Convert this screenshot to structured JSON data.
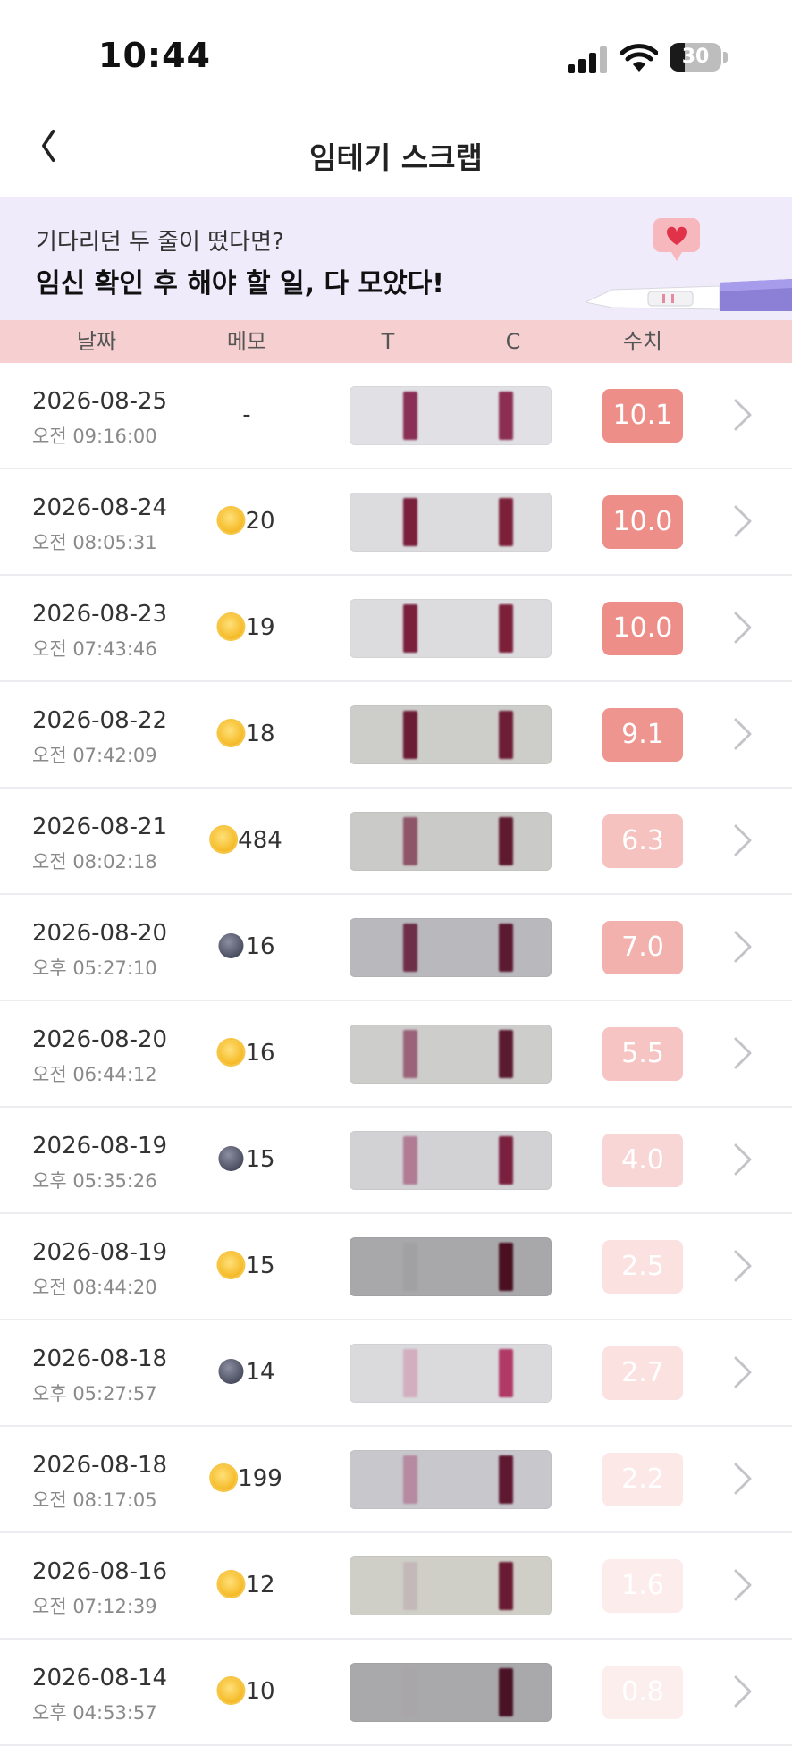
{
  "status_bar": {
    "time": "10:44",
    "battery_level": "30",
    "battery_fraction": 0.3
  },
  "header": {
    "title": "임테기 스크랩"
  },
  "banner": {
    "subtitle": "기다리던 두 줄이 떴다면?",
    "title": "임신 확인 후 해야 할 일, 다 모았다!"
  },
  "table": {
    "columns": {
      "date": "날짜",
      "memo": "메모",
      "t": "T",
      "c": "C",
      "value": "수치"
    },
    "rows": [
      {
        "date": "2026-08-25",
        "time": "오전 09:16:00",
        "memo_icon": "",
        "memo": "-",
        "value": "10.1",
        "badge_color": "#ee8e89",
        "strip_bg": "#e1e1e5",
        "t_color": "#8a2f55",
        "c_color": "#8c2e50"
      },
      {
        "date": "2026-08-24",
        "time": "오전 08:05:31",
        "memo_icon": "sun",
        "memo": "20",
        "value": "10.0",
        "badge_color": "#ee8e89",
        "strip_bg": "#dcdcde",
        "t_color": "#7a1f3c",
        "c_color": "#7c203a"
      },
      {
        "date": "2026-08-23",
        "time": "오전 07:43:46",
        "memo_icon": "sun",
        "memo": "19",
        "value": "10.0",
        "badge_color": "#ee8e89",
        "strip_bg": "#dcdcdf",
        "t_color": "#7a1f3c",
        "c_color": "#7c203a"
      },
      {
        "date": "2026-08-22",
        "time": "오전 07:42:09",
        "memo_icon": "sun",
        "memo": "18",
        "value": "9.1",
        "badge_color": "#ef9590",
        "strip_bg": "#cdcdc9",
        "t_color": "#6b1d35",
        "c_color": "#6d1d35"
      },
      {
        "date": "2026-08-21",
        "time": "오전 08:02:18",
        "memo_icon": "sun",
        "memo": "484",
        "value": "6.3",
        "badge_color": "#f6c2c0",
        "strip_bg": "#cacac8",
        "t_color": "#8e5468",
        "c_color": "#5f1a30"
      },
      {
        "date": "2026-08-20",
        "time": "오후 05:27:10",
        "memo_icon": "moon",
        "memo": "16",
        "value": "7.0",
        "badge_color": "#f3b1ae",
        "strip_bg": "#b9b9bd",
        "t_color": "#6e2f46",
        "c_color": "#5b1a30"
      },
      {
        "date": "2026-08-20",
        "time": "오전 06:44:12",
        "memo_icon": "sun",
        "memo": "16",
        "value": "5.5",
        "badge_color": "#f6c5c3",
        "strip_bg": "#cdcdcc",
        "t_color": "#9a6379",
        "c_color": "#5a1b31"
      },
      {
        "date": "2026-08-19",
        "time": "오후 05:35:26",
        "memo_icon": "moon",
        "memo": "15",
        "value": "4.0",
        "badge_color": "#f8d6d5",
        "strip_bg": "#d2d2d5",
        "t_color": "#b07b93",
        "c_color": "#7a203e"
      },
      {
        "date": "2026-08-19",
        "time": "오전 08:44:20",
        "memo_icon": "sun",
        "memo": "15",
        "value": "2.5",
        "badge_color": "#fbe2e1",
        "strip_bg": "#a8a8aa",
        "t_color": "#a1a0a2",
        "c_color": "#4a1022"
      },
      {
        "date": "2026-08-18",
        "time": "오후 05:27:57",
        "memo_icon": "moon",
        "memo": "14",
        "value": "2.7",
        "badge_color": "#fbe2e1",
        "strip_bg": "#dadadc",
        "t_color": "#d2aebe",
        "c_color": "#b03a65"
      },
      {
        "date": "2026-08-18",
        "time": "오전 08:17:05",
        "memo_icon": "sun",
        "memo": "199",
        "value": "2.2",
        "badge_color": "#fce8e7",
        "strip_bg": "#c7c7cc",
        "t_color": "#b68aa0",
        "c_color": "#5e1830"
      },
      {
        "date": "2026-08-16",
        "time": "오전 07:12:39",
        "memo_icon": "sun",
        "memo": "12",
        "value": "1.6",
        "badge_color": "#fdecec",
        "strip_bg": "#cfcfc8",
        "t_color": "#c4b8b9",
        "c_color": "#6a1b34"
      },
      {
        "date": "2026-08-14",
        "time": "오후 04:53:57",
        "memo_icon": "sun",
        "memo": "10",
        "value": "0.8",
        "badge_color": "#fdeeee",
        "strip_bg": "#a9a9ab",
        "t_color": "#a8a6a8",
        "c_color": "#4a1225"
      }
    ]
  }
}
